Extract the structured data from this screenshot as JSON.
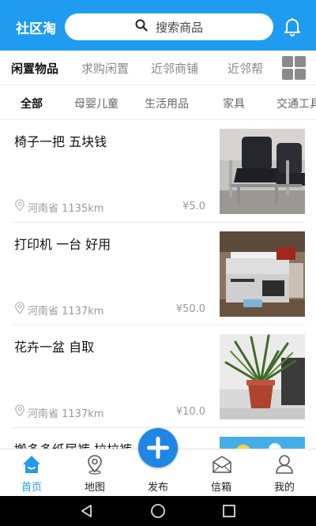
{
  "header": {
    "app_title": "社区淘",
    "search_placeholder": "搜索商品"
  },
  "main_tabs": [
    {
      "label": "闲置物品",
      "active": true
    },
    {
      "label": "求购闲置",
      "active": false
    },
    {
      "label": "近邻商铺",
      "active": false
    },
    {
      "label": "近邻帮",
      "active": false
    }
  ],
  "sub_tabs": [
    {
      "label": "全部",
      "active": true
    },
    {
      "label": "母婴儿童",
      "active": false
    },
    {
      "label": "生活用品",
      "active": false
    },
    {
      "label": "家具",
      "active": false
    },
    {
      "label": "交通工具",
      "active": false
    }
  ],
  "items": [
    {
      "title": "椅子一把 五块钱",
      "location": "河南省 1135km",
      "price": "¥5.0",
      "photo": "chair-photo"
    },
    {
      "title": "打印机 一台 好用",
      "location": "河南省 1137km",
      "price": "¥50.0",
      "photo": "printer-photo"
    },
    {
      "title": "花卉一盆 自取",
      "location": "河南省 1137km",
      "price": "¥10.0",
      "photo": "plant-photo"
    },
    {
      "title": "搬多多纸尿裤 拉拉裤",
      "location": "",
      "price": "",
      "photo": "diaper-photo"
    }
  ],
  "bottom_nav": [
    {
      "label": "首页",
      "icon": "home-icon",
      "active": true
    },
    {
      "label": "地图",
      "icon": "map-pin-icon",
      "active": false
    },
    {
      "label": "发布",
      "icon": "plus-icon",
      "active": false
    },
    {
      "label": "信箱",
      "icon": "mail-icon",
      "active": false
    },
    {
      "label": "我的",
      "icon": "user-icon",
      "active": false
    }
  ],
  "colors": {
    "brand": "#1f9bf0",
    "fab": "#1f86e6",
    "muted_text": "#999999"
  }
}
